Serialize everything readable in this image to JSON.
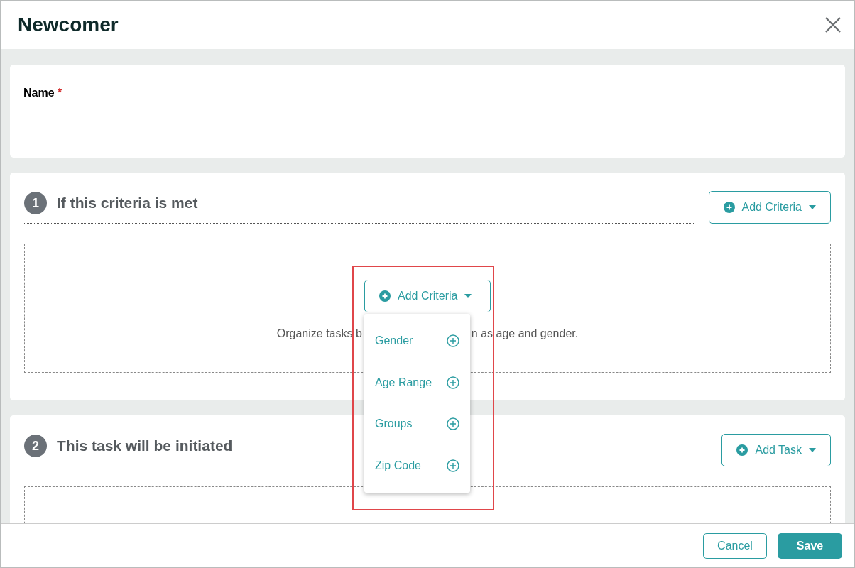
{
  "dialog": {
    "title": "Newcomer"
  },
  "name_field": {
    "label": "Name",
    "required_mark": "*"
  },
  "sections": [
    {
      "number": "1",
      "title": "If this criteria is met",
      "button": "Add Criteria",
      "inline_button": "Add Criteria",
      "hint_parts": [
        "Organize tasks b",
        "n as age and gender."
      ],
      "menu": {
        "open": true,
        "highlighted": true,
        "items": [
          "Gender",
          "Age Range",
          "Groups",
          "Zip Code"
        ]
      }
    },
    {
      "number": "2",
      "title": "This task will be initiated",
      "button": "Add Task"
    }
  ],
  "footer": {
    "buttons": [
      {
        "label": "Cancel",
        "kind": "secondary"
      },
      {
        "label": "Save",
        "kind": "primary"
      }
    ]
  }
}
